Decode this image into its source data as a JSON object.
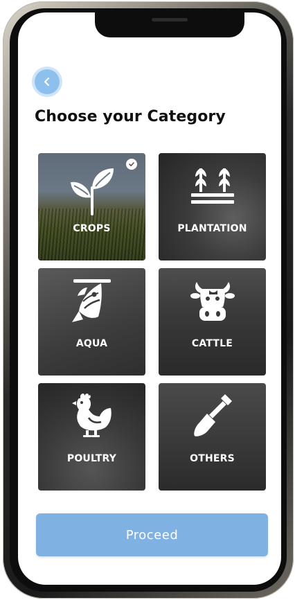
{
  "header": {
    "back_icon": "chevron-left-icon",
    "title": "Choose your Category"
  },
  "categories": [
    {
      "label": "CROPS",
      "icon": "sprout-icon",
      "selected": true
    },
    {
      "label": "PLANTATION",
      "icon": "plantation-rows-icon",
      "selected": false
    },
    {
      "label": "AQUA",
      "icon": "fish-icon",
      "selected": false
    },
    {
      "label": "CATTLE",
      "icon": "cow-icon",
      "selected": false
    },
    {
      "label": "POULTRY",
      "icon": "chicken-icon",
      "selected": false
    },
    {
      "label": "OTHERS",
      "icon": "shovel-icon",
      "selected": false
    }
  ],
  "footer": {
    "proceed_label": "Proceed"
  },
  "colors": {
    "accent": "#8ec0ee",
    "proceed_button": "#7fb1e3",
    "title_text": "#111111"
  }
}
